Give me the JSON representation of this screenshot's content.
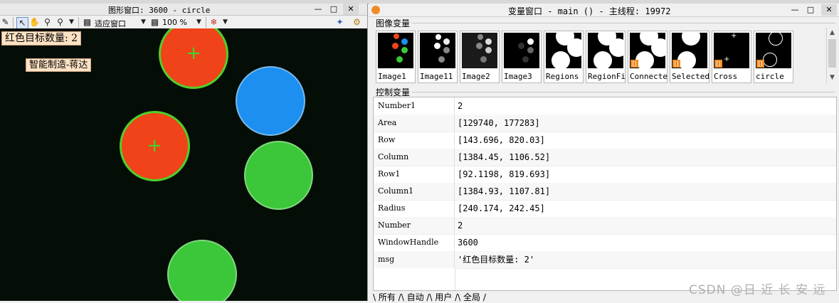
{
  "graphics_window": {
    "title": "图形窗口: 3600 - circle",
    "fit_window_label": "适应窗口",
    "zoom_level": "100 %",
    "overlay_text": {
      "count_message": "红色目标数量: 2",
      "author": "智能制造-蒋达"
    }
  },
  "variable_window": {
    "title": "变量窗口 - main () - 主线程: 19972",
    "iconic_section_label": "图像变量",
    "control_section_label": "控制变量",
    "iconic_variables": [
      {
        "name": "Image1",
        "icon": "color-image"
      },
      {
        "name": "Image11",
        "icon": "gray-image"
      },
      {
        "name": "Image2",
        "icon": "gray-image"
      },
      {
        "name": "Image3",
        "icon": "gray-image"
      },
      {
        "name": "Regions",
        "icon": "region"
      },
      {
        "name": "RegionFi",
        "icon": "region"
      },
      {
        "name": "Connecte",
        "icon": "region-array"
      },
      {
        "name": "Selected",
        "icon": "region-array"
      },
      {
        "name": "Cross",
        "icon": "region-array"
      },
      {
        "name": "circle",
        "icon": "region-array"
      }
    ],
    "control_variables": [
      {
        "name": "Number1",
        "value": "2"
      },
      {
        "name": "Area",
        "value": "[129740, 177283]"
      },
      {
        "name": "Row",
        "value": "[143.696, 820.03]"
      },
      {
        "name": "Column",
        "value": "[1384.45, 1106.52]"
      },
      {
        "name": "Row1",
        "value": "[92.1198, 819.693]"
      },
      {
        "name": "Column1",
        "value": "[1384.93, 1107.81]"
      },
      {
        "name": "Radius",
        "value": "[240.174, 242.45]"
      },
      {
        "name": "Number",
        "value": "2"
      },
      {
        "name": "WindowHandle",
        "value": "3600"
      },
      {
        "name": "msg",
        "value": "'红色目标数量: 2'"
      }
    ],
    "tabs": "\\ 所有 /\\ 自动 /\\ 用户 /\\ 全局 /"
  },
  "watermark": "CSDN @日 近 长 安 远",
  "colors": {
    "red_target": "#f0431a",
    "blue_target": "#1c8ff0",
    "green_target": "#3cc63a",
    "contour": "#42d22a",
    "accent": "#f08a24"
  }
}
